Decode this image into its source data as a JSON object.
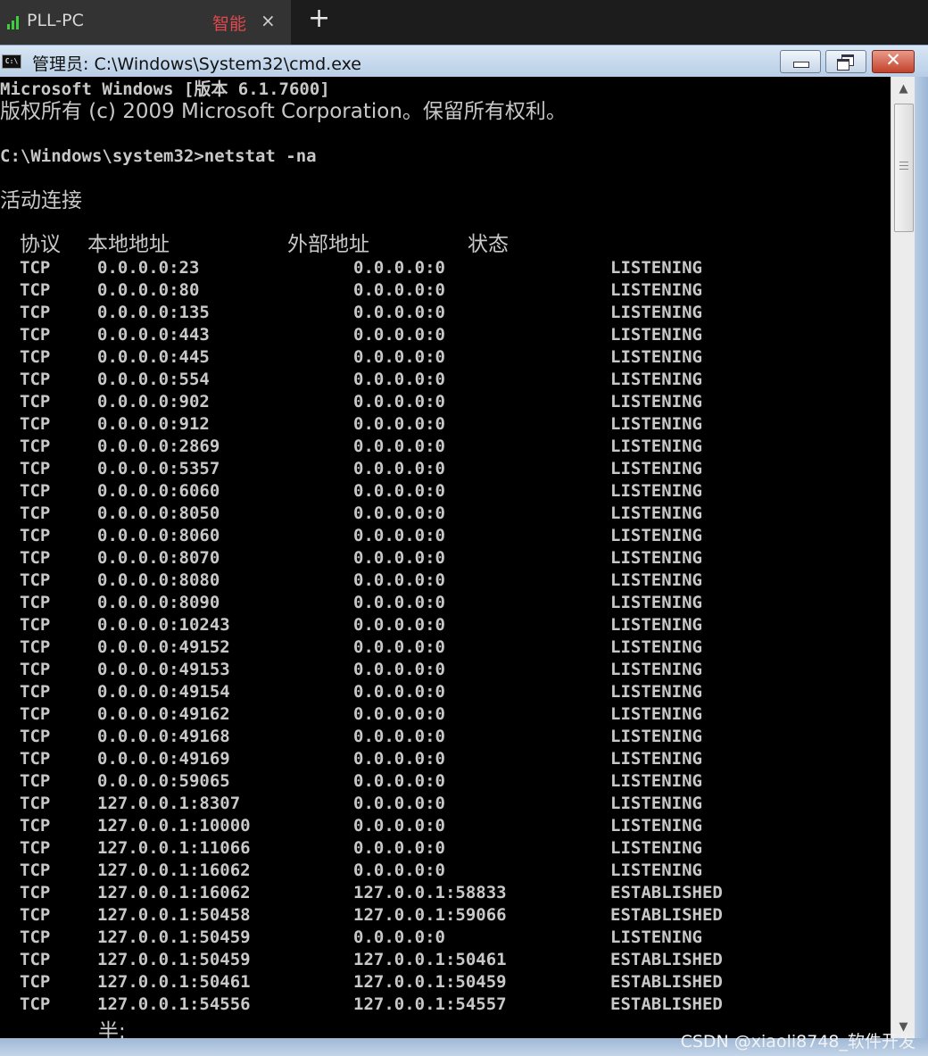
{
  "remote_tab": {
    "title": "PLL-PC",
    "quality": "智能",
    "close": "×",
    "add": "+"
  },
  "window": {
    "title": "管理员: C:\\Windows\\System32\\cmd.exe",
    "close": "✕"
  },
  "console": {
    "banner1": "Microsoft Windows [版本 6.1.7600]",
    "banner2": "版权所有 (c) 2009 Microsoft Corporation。保留所有权利。",
    "prompt": "C:\\Windows\\system32>netstat -na",
    "section": "活动连接",
    "headers": [
      "协议",
      "本地地址",
      "外部地址",
      "状态"
    ],
    "rows": [
      [
        "TCP",
        "0.0.0.0:23",
        "0.0.0.0:0",
        "LISTENING"
      ],
      [
        "TCP",
        "0.0.0.0:80",
        "0.0.0.0:0",
        "LISTENING"
      ],
      [
        "TCP",
        "0.0.0.0:135",
        "0.0.0.0:0",
        "LISTENING"
      ],
      [
        "TCP",
        "0.0.0.0:443",
        "0.0.0.0:0",
        "LISTENING"
      ],
      [
        "TCP",
        "0.0.0.0:445",
        "0.0.0.0:0",
        "LISTENING"
      ],
      [
        "TCP",
        "0.0.0.0:554",
        "0.0.0.0:0",
        "LISTENING"
      ],
      [
        "TCP",
        "0.0.0.0:902",
        "0.0.0.0:0",
        "LISTENING"
      ],
      [
        "TCP",
        "0.0.0.0:912",
        "0.0.0.0:0",
        "LISTENING"
      ],
      [
        "TCP",
        "0.0.0.0:2869",
        "0.0.0.0:0",
        "LISTENING"
      ],
      [
        "TCP",
        "0.0.0.0:5357",
        "0.0.0.0:0",
        "LISTENING"
      ],
      [
        "TCP",
        "0.0.0.0:6060",
        "0.0.0.0:0",
        "LISTENING"
      ],
      [
        "TCP",
        "0.0.0.0:8050",
        "0.0.0.0:0",
        "LISTENING"
      ],
      [
        "TCP",
        "0.0.0.0:8060",
        "0.0.0.0:0",
        "LISTENING"
      ],
      [
        "TCP",
        "0.0.0.0:8070",
        "0.0.0.0:0",
        "LISTENING"
      ],
      [
        "TCP",
        "0.0.0.0:8080",
        "0.0.0.0:0",
        "LISTENING"
      ],
      [
        "TCP",
        "0.0.0.0:8090",
        "0.0.0.0:0",
        "LISTENING"
      ],
      [
        "TCP",
        "0.0.0.0:10243",
        "0.0.0.0:0",
        "LISTENING"
      ],
      [
        "TCP",
        "0.0.0.0:49152",
        "0.0.0.0:0",
        "LISTENING"
      ],
      [
        "TCP",
        "0.0.0.0:49153",
        "0.0.0.0:0",
        "LISTENING"
      ],
      [
        "TCP",
        "0.0.0.0:49154",
        "0.0.0.0:0",
        "LISTENING"
      ],
      [
        "TCP",
        "0.0.0.0:49162",
        "0.0.0.0:0",
        "LISTENING"
      ],
      [
        "TCP",
        "0.0.0.0:49168",
        "0.0.0.0:0",
        "LISTENING"
      ],
      [
        "TCP",
        "0.0.0.0:49169",
        "0.0.0.0:0",
        "LISTENING"
      ],
      [
        "TCP",
        "0.0.0.0:59065",
        "0.0.0.0:0",
        "LISTENING"
      ],
      [
        "TCP",
        "127.0.0.1:8307",
        "0.0.0.0:0",
        "LISTENING"
      ],
      [
        "TCP",
        "127.0.0.1:10000",
        "0.0.0.0:0",
        "LISTENING"
      ],
      [
        "TCP",
        "127.0.0.1:11066",
        "0.0.0.0:0",
        "LISTENING"
      ],
      [
        "TCP",
        "127.0.0.1:16062",
        "0.0.0.0:0",
        "LISTENING"
      ],
      [
        "TCP",
        "127.0.0.1:16062",
        "127.0.0.1:58833",
        "ESTABLISHED"
      ],
      [
        "TCP",
        "127.0.0.1:50458",
        "127.0.0.1:59066",
        "ESTABLISHED"
      ],
      [
        "TCP",
        "127.0.0.1:50459",
        "0.0.0.0:0",
        "LISTENING"
      ],
      [
        "TCP",
        "127.0.0.1:50459",
        "127.0.0.1:50461",
        "ESTABLISHED"
      ],
      [
        "TCP",
        "127.0.0.1:50461",
        "127.0.0.1:50459",
        "ESTABLISHED"
      ],
      [
        "TCP",
        "127.0.0.1:54556",
        "127.0.0.1:54557",
        "ESTABLISHED"
      ]
    ],
    "more_prompt": "半:"
  },
  "watermark": "CSDN @xiaoli8748_软件开发",
  "icons": [
    "signal-icon",
    "cmd-icon",
    "minimize-icon",
    "maximize-icon",
    "close-icon",
    "scroll-up-icon",
    "scroll-down-icon"
  ],
  "colors": {
    "console_bg": "#000000",
    "console_text": "#c8c8c8",
    "signal": "#3cd03c",
    "quality": "#e0484c",
    "close_button": "#c2422a",
    "titlebar": "#c9daee"
  }
}
